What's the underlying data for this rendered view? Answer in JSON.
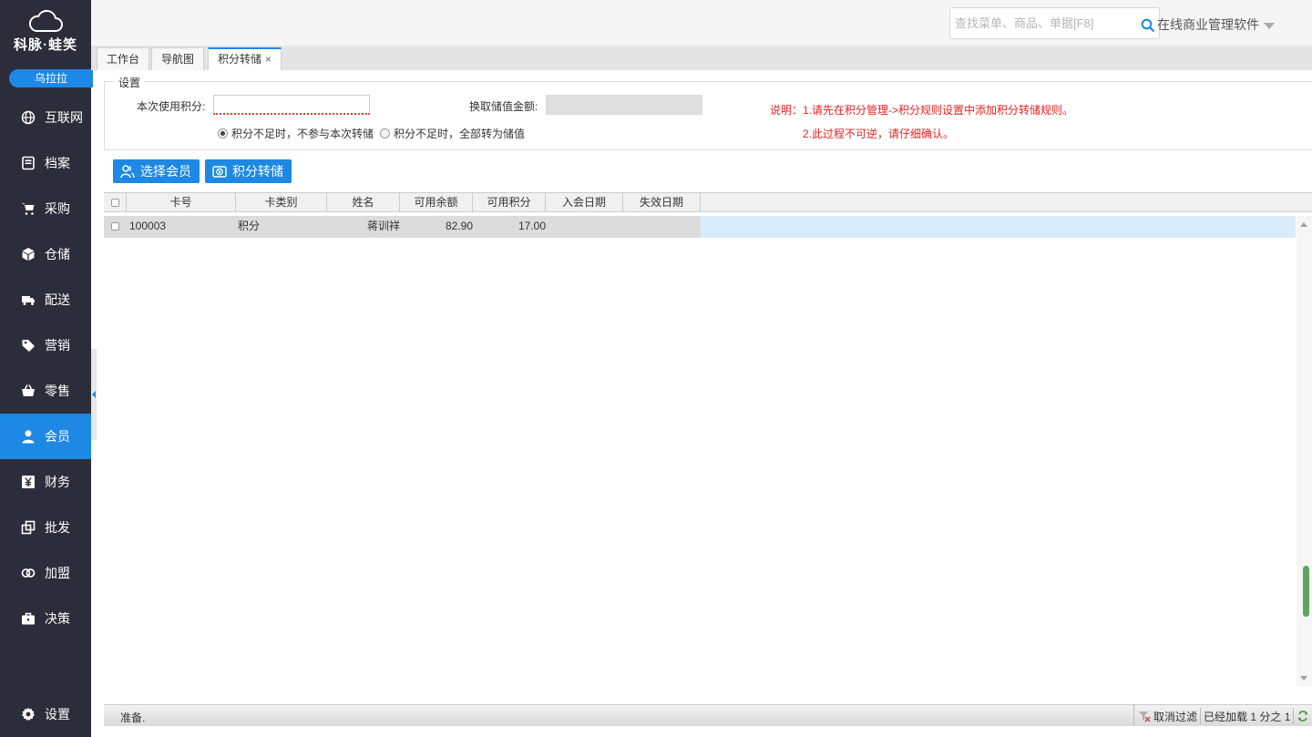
{
  "brand": {
    "name": "科脉·蛙笑",
    "user": "乌拉拉"
  },
  "sidebar": {
    "items": [
      {
        "label": "互联网",
        "icon": "globe-icon"
      },
      {
        "label": "档案",
        "icon": "document-icon"
      },
      {
        "label": "采购",
        "icon": "cart-icon"
      },
      {
        "label": "仓储",
        "icon": "box-icon"
      },
      {
        "label": "配送",
        "icon": "truck-icon"
      },
      {
        "label": "营销",
        "icon": "tag-icon"
      },
      {
        "label": "零售",
        "icon": "basket-icon"
      },
      {
        "label": "会员",
        "icon": "user-icon",
        "active": true
      },
      {
        "label": "财务",
        "icon": "yen-icon"
      },
      {
        "label": "批发",
        "icon": "copy-icon"
      },
      {
        "label": "加盟",
        "icon": "rings-icon"
      },
      {
        "label": "决策",
        "icon": "briefcase-icon"
      }
    ],
    "settings_label": "设置"
  },
  "header": {
    "search_placeholder": "查找菜单、商品、单据[F8]",
    "company": "在线商业管理软件"
  },
  "tabs": [
    {
      "label": "工作台"
    },
    {
      "label": "导航图"
    },
    {
      "label": "积分转储",
      "active": true,
      "closable": "×"
    }
  ],
  "settings": {
    "legend": "设置",
    "use_points_label": "本次使用积分:",
    "use_points_value": "",
    "exchange_label": "换取储值金额:",
    "exchange_value": "",
    "radio1": "积分不足时，不参与本次转储",
    "radio2": "积分不足时，全部转为储值",
    "note1": "说明：1.请先在积分管理->积分规则设置中添加积分转储规则。",
    "note2": "2.此过程不可逆，请仔细确认。"
  },
  "buttons": {
    "select_member": "选择会员",
    "points_transfer": "积分转储"
  },
  "grid": {
    "columns": [
      "卡号",
      "卡类别",
      "姓名",
      "可用余额",
      "可用积分",
      "入会日期",
      "失效日期"
    ],
    "rows": [
      {
        "card_no": "100003",
        "card_type": "积分",
        "name": "蒋训祥",
        "balance": "82.90",
        "points": "17.00",
        "join_date": "",
        "expire_date": ""
      }
    ]
  },
  "status": {
    "left": "准备.",
    "cancel_filter": "取消过滤",
    "loaded": "已经加载 1 分之 1"
  },
  "colors": {
    "sidebar_bg": "#2b2d3b",
    "accent": "#1e88e5",
    "note_red": "#e52222",
    "selected_row": "#d7ebfa"
  }
}
